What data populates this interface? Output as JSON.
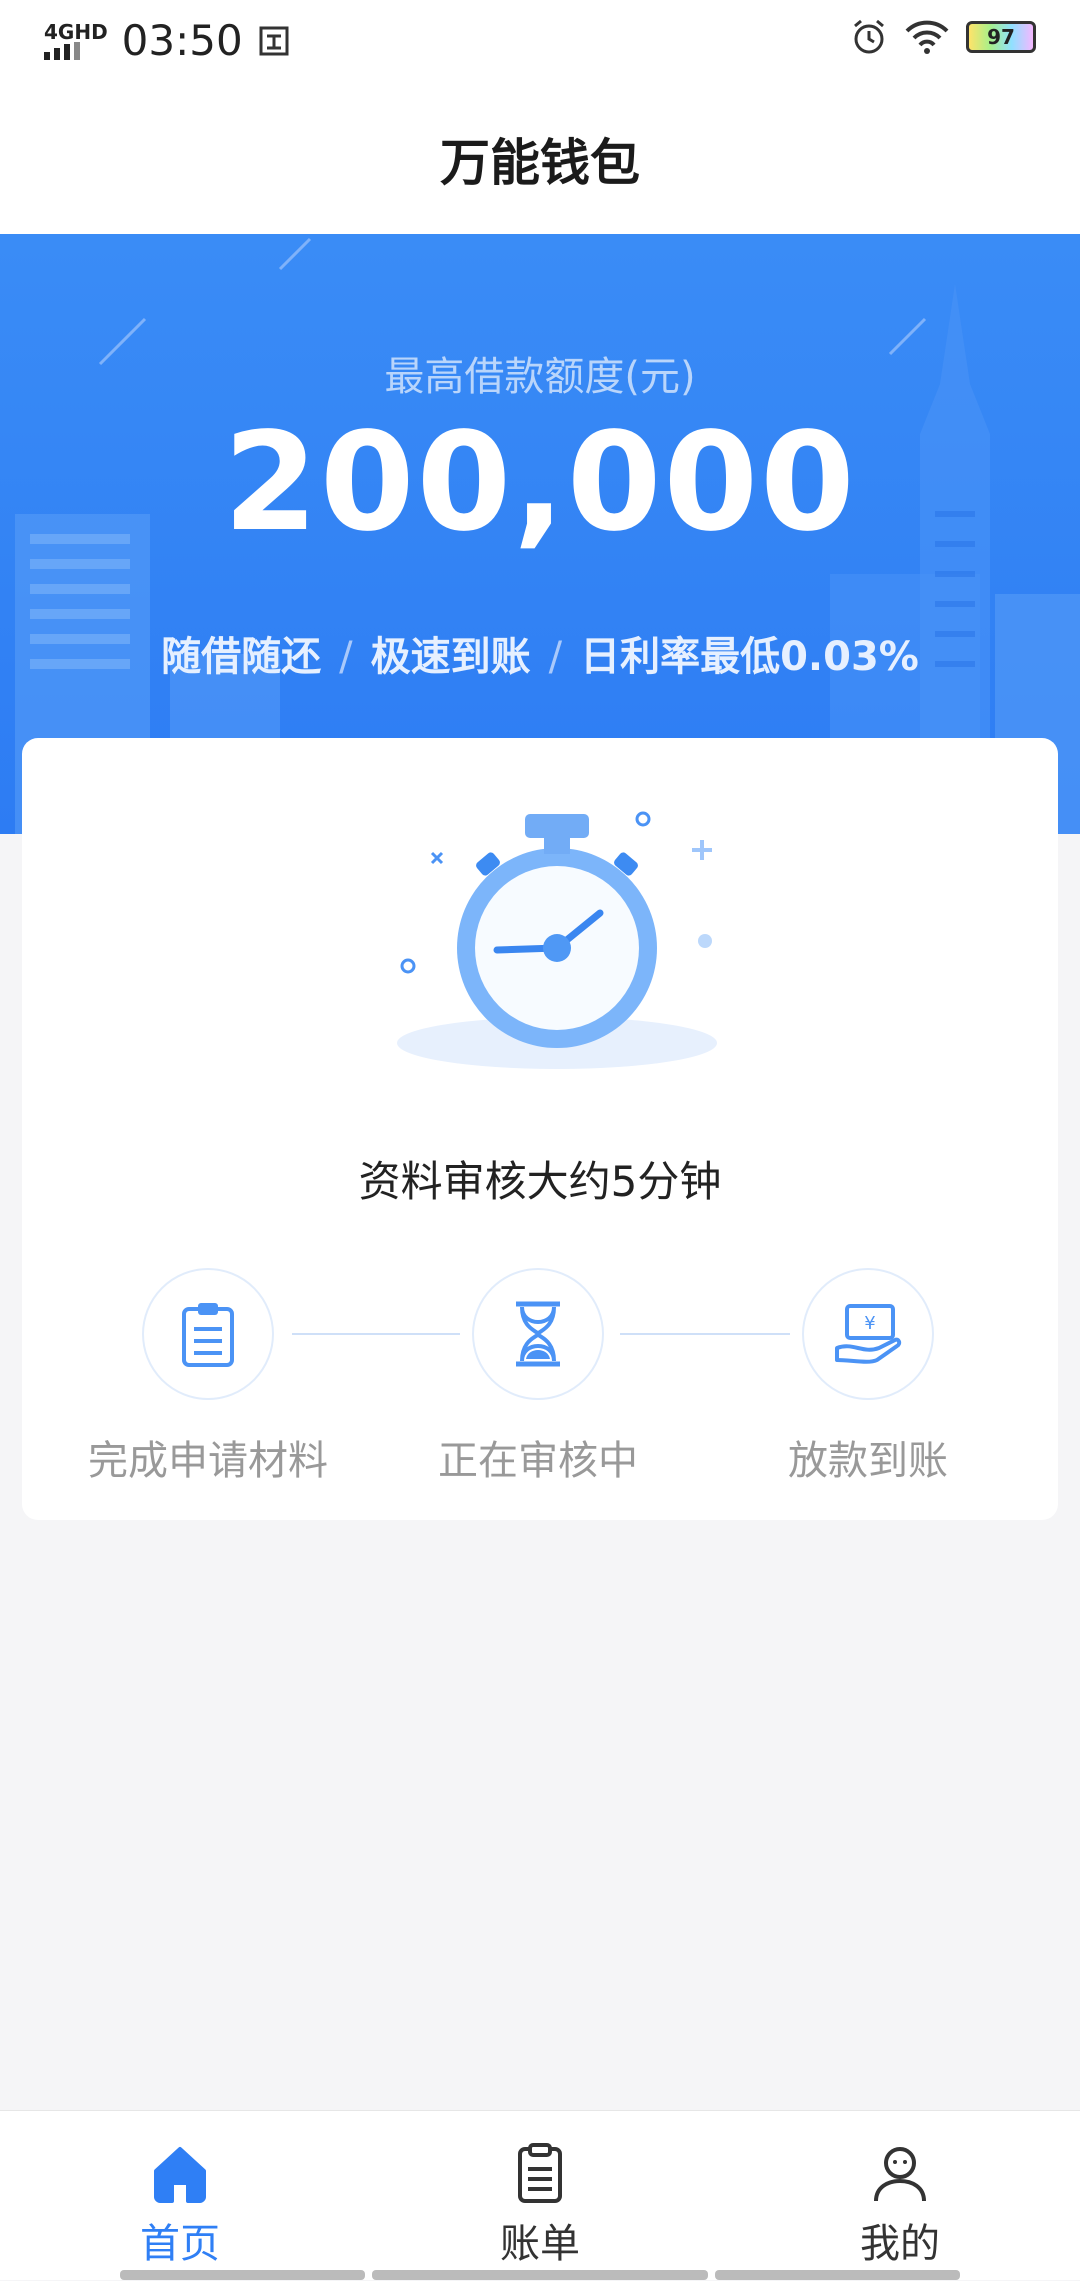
{
  "status_bar": {
    "network": "4GHD",
    "time": "03:50",
    "battery": "97"
  },
  "title": "万能钱包",
  "hero": {
    "subtitle": "最高借款额度(元)",
    "amount": "200,000",
    "features": [
      "随借随还",
      "极速到账",
      "日利率最低0.03%"
    ],
    "separator": "/"
  },
  "card": {
    "review_text": "资料审核大约5分钟",
    "steps": [
      {
        "label": "完成申请材料",
        "icon": "clipboard-icon"
      },
      {
        "label": "正在审核中",
        "icon": "hourglass-icon"
      },
      {
        "label": "放款到账",
        "icon": "money-hand-icon"
      }
    ]
  },
  "tabbar": {
    "tabs": [
      {
        "label": "首页",
        "icon": "home-icon",
        "active": true
      },
      {
        "label": "账单",
        "icon": "bill-icon",
        "active": false
      },
      {
        "label": "我的",
        "icon": "profile-icon",
        "active": false
      }
    ]
  },
  "colors": {
    "brand": "#2f7ff5",
    "hero_bg": "#3a8cf6",
    "page_bg": "#f5f5f7"
  }
}
